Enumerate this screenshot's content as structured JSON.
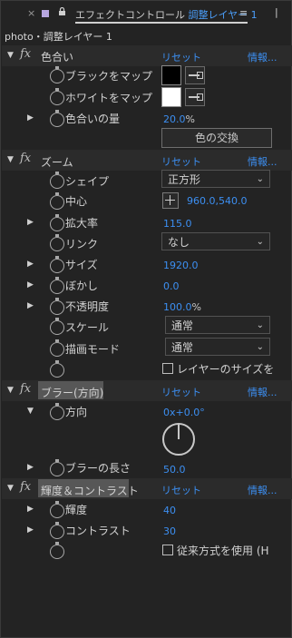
{
  "tab": {
    "close": "×",
    "title_prefix": "エフェクトコントロール",
    "title_layer": "調整レイヤー 1",
    "menu": "≡",
    "sep": "|"
  },
  "breadcrumb": "photo・調整レイヤー 1",
  "common": {
    "reset": "リセット",
    "info": "情報..."
  },
  "tint": {
    "title": "色合い",
    "map_black": "ブラックをマップ",
    "map_white": "ホワイトをマップ",
    "amount_label": "色合いの量",
    "amount_value": "20.0",
    "amount_unit": "%",
    "swap_button": "色の交換",
    "black_color": "#000000",
    "white_color": "#ffffff"
  },
  "zoom": {
    "title": "ズーム",
    "shape_label": "シェイプ",
    "shape_value": "正方形",
    "center_label": "中心",
    "center_value": "960.0,540.0",
    "magnify_label": "拡大率",
    "magnify_value": "115.0",
    "link_label": "リンク",
    "link_value": "なし",
    "size_label": "サイズ",
    "size_value": "1920.0",
    "blur_label": "ぼかし",
    "blur_value": "0.0",
    "opacity_label": "不透明度",
    "opacity_value": "100.0",
    "opacity_unit": "%",
    "scale_label": "スケール",
    "scale_value": "通常",
    "blend_label": "描画モード",
    "blend_value": "通常",
    "resize_layer_label": "レイヤーのサイズを"
  },
  "dblur": {
    "title": "ブラー(方向)",
    "direction_label": "方向",
    "direction_value": "0x+0.0°",
    "length_label": "ブラーの長さ",
    "length_value": "50.0"
  },
  "bc": {
    "title": "輝度＆コントラスト",
    "brightness_label": "輝度",
    "brightness_value": "40",
    "contrast_label": "コントラスト",
    "contrast_value": "30",
    "legacy_label": "従来方式を使用 (H"
  },
  "chev": "⌄",
  "arrow_open": "▼",
  "arrow_closed": "▶",
  "fx": "fx"
}
